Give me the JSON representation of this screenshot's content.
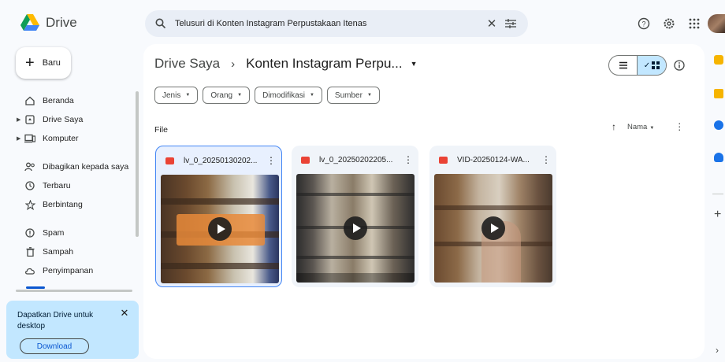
{
  "app": {
    "name": "Drive"
  },
  "search": {
    "query": "Telusuri di Konten Instagram Perpustakaan Itenas"
  },
  "sidebar": {
    "new_label": "Baru",
    "items": [
      {
        "label": "Beranda",
        "icon": "home-icon"
      },
      {
        "label": "Drive Saya",
        "icon": "my-drive-icon",
        "expandable": true
      },
      {
        "label": "Komputer",
        "icon": "computer-icon",
        "expandable": true
      },
      {
        "label": "Dibagikan kepada saya",
        "icon": "shared-icon"
      },
      {
        "label": "Terbaru",
        "icon": "clock-icon"
      },
      {
        "label": "Berbintang",
        "icon": "star-icon"
      },
      {
        "label": "Spam",
        "icon": "spam-icon"
      },
      {
        "label": "Sampah",
        "icon": "trash-icon"
      },
      {
        "label": "Penyimpanan",
        "icon": "cloud-icon"
      }
    ],
    "promo": {
      "text": "Dapatkan Drive untuk desktop",
      "button": "Download"
    }
  },
  "breadcrumb": {
    "root": "Drive Saya",
    "sep": "›",
    "current": "Konten Instagram Perpu..."
  },
  "filters": [
    {
      "label": "Jenis"
    },
    {
      "label": "Orang"
    },
    {
      "label": "Dimodifikasi"
    },
    {
      "label": "Sumber"
    }
  ],
  "section": {
    "label": "File"
  },
  "sort": {
    "label": "Nama"
  },
  "files": [
    {
      "name": "lv_0_20250130202...",
      "selected": true
    },
    {
      "name": "lv_0_20250202205...",
      "selected": false
    },
    {
      "name": "VID-20250124-WA...",
      "selected": false
    }
  ],
  "colors": {
    "accent": "#0b57d0",
    "selected_bg": "#c2e7ff",
    "panel_bg": "#f8fafd",
    "video_red": "#ea4335"
  }
}
